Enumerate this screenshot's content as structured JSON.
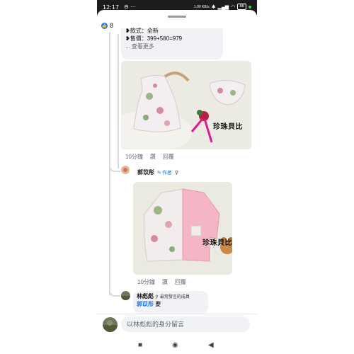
{
  "status_bar": {
    "time": "12:17",
    "left_icons": "⊖ ···",
    "network": "1.00 KB/s",
    "battery": "88"
  },
  "reaction": {
    "icon": "like-icon",
    "count": "8"
  },
  "comment1": {
    "line_partial": "❥款式：全新",
    "price": "❥售價：399+580=979",
    "see_more": "... 查看更多",
    "time": "10分鐘",
    "like": "讚",
    "reply": "回覆",
    "watermark": "珍珠貝比"
  },
  "reply_author": {
    "name": "郭苡彤",
    "badge": "作者",
    "time": "10分鐘",
    "like": "讚",
    "reply": "回覆",
    "watermark": "珍珠貝比"
  },
  "reply2": {
    "name": "林彪彪",
    "tag": "最常發言的成員",
    "mention": "郭苡彤",
    "text": " 要"
  },
  "input": {
    "placeholder": "以林彪彪的身分留言"
  },
  "colors": {
    "accent": "#1877f2",
    "bubble": "#f0f2f5"
  }
}
